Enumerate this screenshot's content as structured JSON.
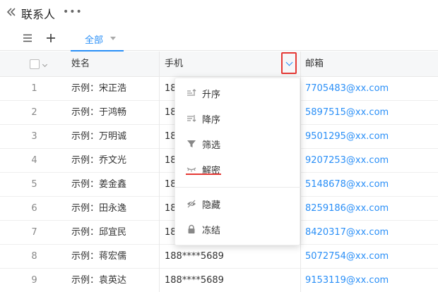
{
  "header": {
    "title": "联系人",
    "more": "•••"
  },
  "toolbar": {
    "view_tab": "全部"
  },
  "columns": {
    "name": "姓名",
    "phone": "手机",
    "email": "邮箱"
  },
  "rows": [
    {
      "idx": "1",
      "name": "示例：宋正浩",
      "phone": "18",
      "email": "7705483@xx.com"
    },
    {
      "idx": "2",
      "name": "示例：于鸿畅",
      "phone": "18",
      "email": "5897515@xx.com"
    },
    {
      "idx": "3",
      "name": "示例：万明诚",
      "phone": "18",
      "email": "9501295@xx.com"
    },
    {
      "idx": "4",
      "name": "示例：乔文光",
      "phone": "18",
      "email": "9207253@xx.com"
    },
    {
      "idx": "5",
      "name": "示例：姜金鑫",
      "phone": "18",
      "email": "5148678@xx.com"
    },
    {
      "idx": "6",
      "name": "示例：田永逸",
      "phone": "18",
      "email": "8259186@xx.com"
    },
    {
      "idx": "7",
      "name": "示例：邱宜民",
      "phone": "18",
      "email": "8420317@xx.com"
    },
    {
      "idx": "8",
      "name": "示例：蒋宏儒",
      "phone": "188****5689",
      "email": "5072754@xx.com"
    },
    {
      "idx": "9",
      "name": "示例：袁英达",
      "phone": "188****5689",
      "email": "9153119@xx.com"
    }
  ],
  "menu": {
    "asc": "升序",
    "desc": "降序",
    "filter": "筛选",
    "decrypt": "解密",
    "hide": "隐藏",
    "freeze": "冻结"
  },
  "colors": {
    "accent": "#2a8ff7",
    "highlight": "#e53935"
  }
}
